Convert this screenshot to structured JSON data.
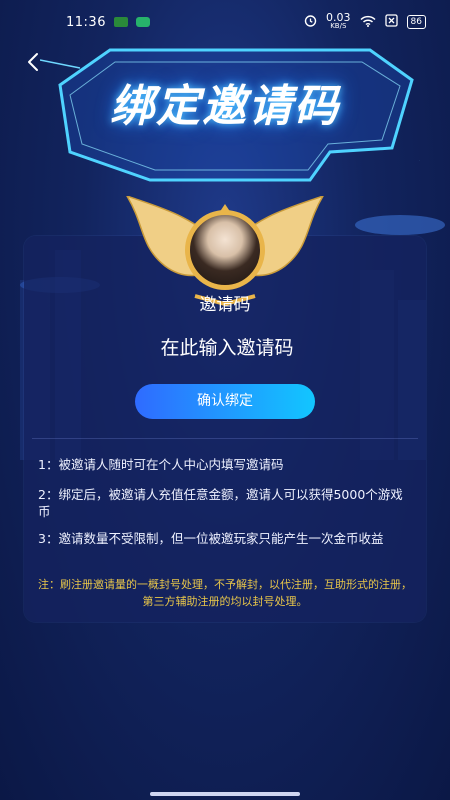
{
  "status_bar": {
    "time": "11:36",
    "speed_value": "0.03",
    "speed_unit": "KB/S",
    "battery": "86"
  },
  "header": {
    "title": "绑定邀请码"
  },
  "invite": {
    "label": "邀请码",
    "input_placeholder": "在此输入邀请码",
    "confirm_label": "确认绑定"
  },
  "rules": [
    "1：被邀请人随时可在个人中心内填写邀请码",
    "2：绑定后，被邀请人充值任意金额，邀请人可以获得5000个游戏币",
    "3：邀请数量不受限制，但一位被邀玩家只能产生一次金币收益"
  ],
  "notice": "注：刷注册邀请量的一概封号处理，不予解封，以代注册，互助形式的注册，第三方辅助注册的均以封号处理。",
  "colors": {
    "accent_start": "#2f6bff",
    "accent_end": "#12c6ff",
    "notice": "#e8c64a",
    "background": "#12245e"
  }
}
